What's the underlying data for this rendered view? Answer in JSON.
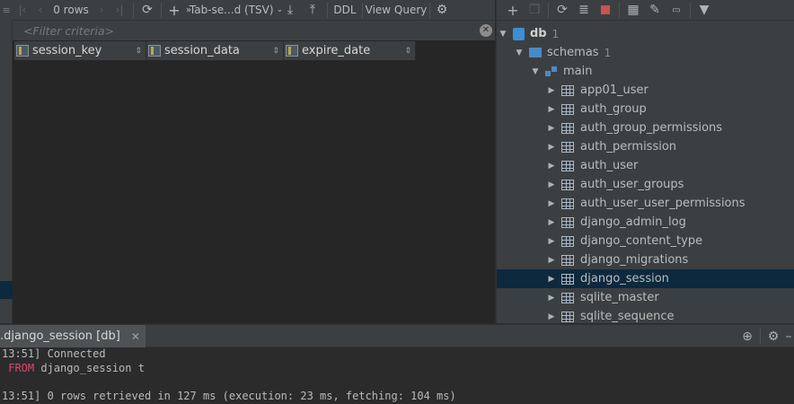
{
  "data_editor": {
    "toolbar": {
      "rows_label": "0 rows",
      "tsv_label": "Tab-se...d (TSV)",
      "ddl_label": "DDL",
      "view_query_label": "View Query"
    },
    "filter": {
      "placeholder": "<Filter criteria>"
    },
    "columns": [
      {
        "name": "session_key"
      },
      {
        "name": "session_data"
      },
      {
        "name": "expire_date"
      }
    ]
  },
  "db_tree": {
    "database": {
      "name": "db",
      "count": "1"
    },
    "schemas": {
      "name": "schemas",
      "count": "1"
    },
    "schema": {
      "name": "main"
    },
    "tables": [
      "app01_user",
      "auth_group",
      "auth_group_permissions",
      "auth_permission",
      "auth_user",
      "auth_user_groups",
      "auth_user_user_permissions",
      "django_admin_log",
      "django_content_type",
      "django_migrations",
      "django_session",
      "sqlite_master",
      "sqlite_sequence"
    ],
    "selected_table": "django_session"
  },
  "console": {
    "tab_label": ".django_session [db]",
    "lines": {
      "connected_time": "13:51] ",
      "connected_text": "Connected",
      "from_kw": "FROM",
      "from_rest": " django_session t",
      "result_time": "13:51] ",
      "result_text": "0 rows retrieved in 127 ms (execution: 23 ms, fetching: 104 ms)"
    }
  },
  "icons": {
    "left_toolbar": [
      "first-page-icon",
      "prev-page-icon",
      "next-page-icon",
      "last-page-icon",
      "refresh-icon",
      "add-row-icon",
      "export-icon",
      "upload-icon",
      "settings-icon"
    ],
    "right_toolbar": [
      "add-icon",
      "copy-icon",
      "refresh-icon",
      "sql-icon",
      "stop-icon",
      "table-icon",
      "edit-icon",
      "console-icon",
      "filter-icon"
    ],
    "console_actions": [
      "target-icon",
      "gear-icon",
      "hide-icon"
    ]
  },
  "colors": {
    "selection": "#0d293e",
    "panel": "#3c3f41",
    "editor_bg": "#262626",
    "keyword": "#e0466b"
  }
}
